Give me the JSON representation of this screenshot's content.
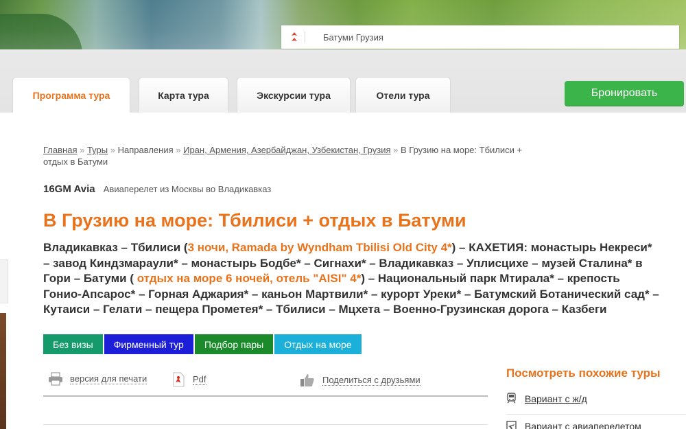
{
  "location": {
    "text": "Батуми  Грузия",
    "icon": "pin-icon"
  },
  "tabs": [
    {
      "label": "Программа тура",
      "active": true
    },
    {
      "label": "Карта тура",
      "active": false
    },
    {
      "label": "Экскурсии тура",
      "active": false
    },
    {
      "label": "Отели тура",
      "active": false
    }
  ],
  "book_button": {
    "label": "Бронировать",
    "color": "#3bb54a"
  },
  "breadcrumbs": {
    "items": [
      "Главная",
      "Туры",
      "Направления",
      "Иран, Армения, Азербайджан, Узбекистан, Грузия",
      "В Грузию на море: Тбилиси + отдых в Батуми"
    ],
    "separator": "»"
  },
  "carrier": {
    "name": "16GM Avia",
    "description": "Авиаперелет из Москвы во Владикавказ"
  },
  "tour_title": "В Грузию на море: Тбилиси + отдых в Батуми",
  "route": {
    "part1": "Владикавказ – Тбилиси (",
    "hl1": "3 ночи, Ramada by Wyndham Tbilisi Old City 4*",
    "part2": ") – КАХЕТИЯ: монастырь Некреси* – завод Киндзмараули* – монастырь Бодбе* – Сигнахи* – Владикавказ – Уплисцихе – музей Сталина* в Гори – Батуми ( ",
    "hl2": "отдых на море 6 ночей, отель \"AISI\" 4*",
    "part3": ") – Национальный парк Мтирала* – крепость Гонио-Апсарос* – Горная Аджария* – каньон Мартвили* – курорт Уреки* – Батумский Ботанический сад* – Кутаиси – Гелати – пещера Прометея* – Тбилиси – Мцхета – Военно-Грузинская дорога – Казбеги"
  },
  "badges": [
    {
      "label": "Без визы",
      "color": "#159a6c"
    },
    {
      "label": "Фирменный тур",
      "color": "#1d1fd8"
    },
    {
      "label": "Подбор пары",
      "color": "#1b8a2a"
    },
    {
      "label": "Отдых на море",
      "color": "#1ab0d9"
    }
  ],
  "tools": {
    "print": {
      "label": "версия для печати",
      "icon": "printer-icon"
    },
    "pdf": {
      "label": "Pdf",
      "icon": "pdf-icon"
    },
    "share": {
      "label": "Поделиться с друзьями",
      "icon": "thumbs-up-icon"
    }
  },
  "similar": {
    "title": "Посмотреть похожие туры",
    "variants": [
      {
        "label": "Вариант с ж/д",
        "icon": "train-icon"
      },
      {
        "label": "Вариант с авиаперелетом",
        "icon": "plane-icon"
      }
    ]
  },
  "accent_color": "#e8731c"
}
